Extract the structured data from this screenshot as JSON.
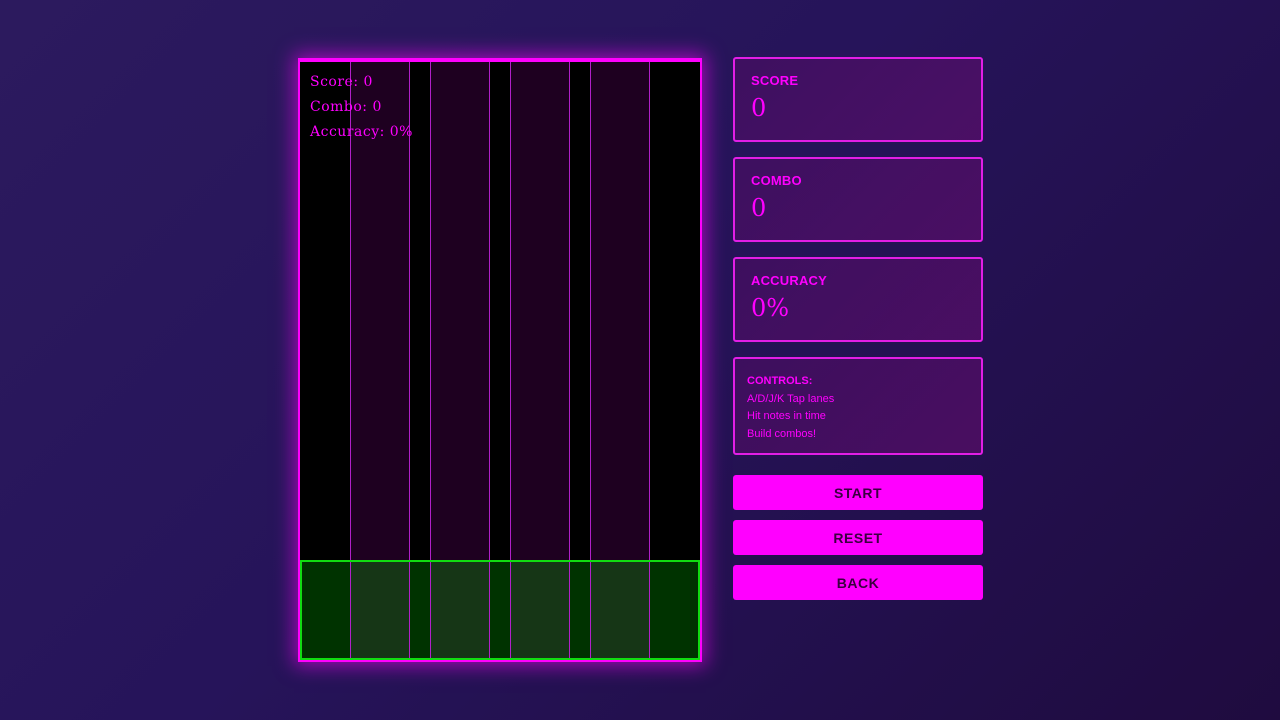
{
  "hud": {
    "score": "Score: 0",
    "combo": "Combo: 0",
    "accuracy": "Accuracy: 0%"
  },
  "stats": {
    "score_label": "SCORE",
    "score_value": "0",
    "combo_label": "COMBO",
    "combo_value": "0",
    "accuracy_label": "ACCURACY",
    "accuracy_value": "0%"
  },
  "controls": {
    "title": "CONTROLS:",
    "lines": [
      "A/D/J/K Tap lanes",
      "Hit notes in time",
      "Build combos!"
    ]
  },
  "buttons": {
    "start": "START",
    "reset": "RESET",
    "back": "BACK"
  },
  "colors": {
    "accent": "#ff00ff",
    "hit_zone": "#11dd11",
    "board_bg": "#000000"
  }
}
